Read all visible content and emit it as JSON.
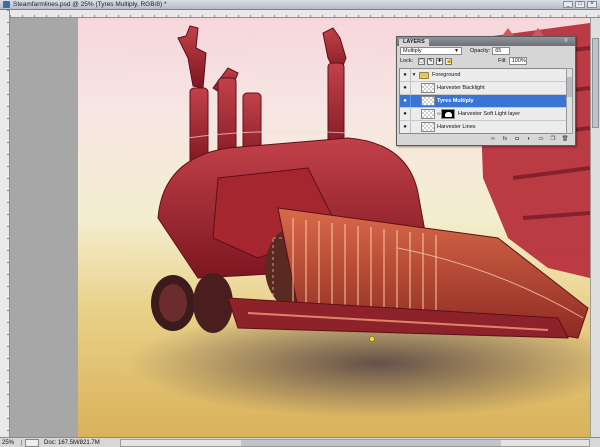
{
  "window": {
    "title": "Steamfarmlines.psd @ 25% (Tyres Multiply, RGB/8) *",
    "buttons": [
      "_",
      "□",
      "×"
    ]
  },
  "status": {
    "zoom": "25%",
    "doc_size": "Doc: 167.5M/821.7M"
  },
  "layers_panel": {
    "tab_label": "LAYERS",
    "menu_icon": "≡",
    "blend_mode": "Multiply",
    "opacity_label": "Opacity:",
    "opacity_value": "65",
    "lock_label": "Lock:",
    "fill_label": "Fill:",
    "fill_value": "100%",
    "lock_icons": [
      "▢",
      "✎",
      "✚",
      "🔒"
    ],
    "layers": [
      {
        "name": "Foreground",
        "kind": "group",
        "visible_glyph": "●"
      },
      {
        "name": "Harvester Backlight",
        "kind": "layer",
        "visible_glyph": "●"
      },
      {
        "name": "Tyres Multiply",
        "kind": "layer",
        "selected": true,
        "visible_glyph": "●"
      },
      {
        "name": "Harvester Soft Light layer",
        "kind": "masked",
        "visible_glyph": "●"
      },
      {
        "name": "Harvester Lines",
        "kind": "layer",
        "visible_glyph": "●"
      }
    ],
    "footer_icons": [
      "link-icon",
      "fx-icon",
      "mask-icon",
      "adjustment-icon",
      "folder-icon",
      "new-layer-icon",
      "trash-icon"
    ],
    "footer_glyphs": [
      "∞",
      "fx",
      "◘",
      "◐",
      "▭",
      "❐",
      "🗑"
    ]
  },
  "colors": {
    "selection": "#3875d7",
    "harvester_red": "#a8232c",
    "sand": "#e9d088"
  }
}
